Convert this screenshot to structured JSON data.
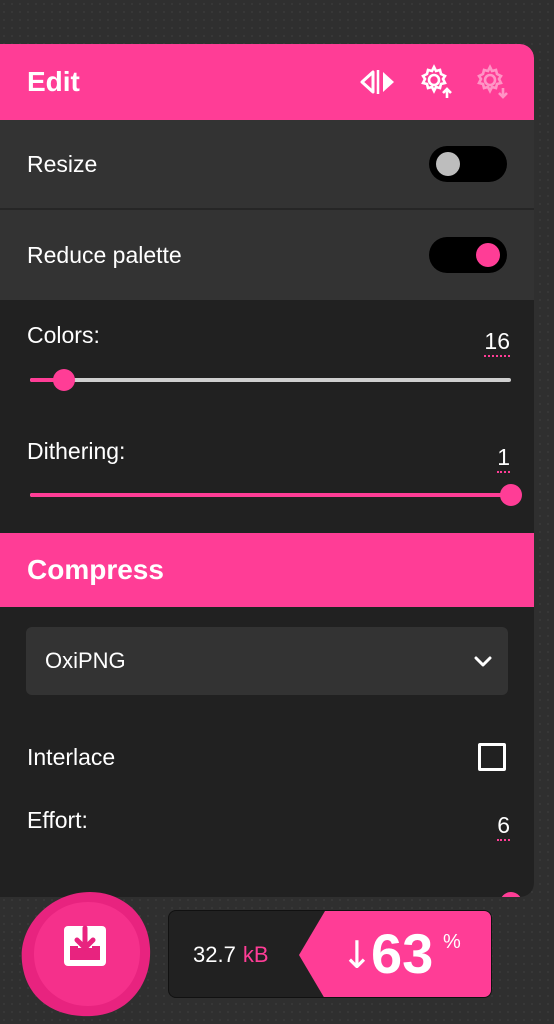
{
  "edit": {
    "title": "Edit",
    "resize_label": "Resize",
    "resize_enabled": false,
    "reduce_palette_label": "Reduce palette",
    "reduce_palette_enabled": true,
    "colors_label": "Colors:",
    "colors_value": "16",
    "colors_level": 0.07,
    "dithering_label": "Dithering:",
    "dithering_value": "1",
    "dithering_level": 1.0
  },
  "compress": {
    "title": "Compress",
    "codec": "OxiPNG",
    "interlace_label": "Interlace",
    "interlace_checked": false,
    "effort_label": "Effort:",
    "effort_value": "6",
    "effort_level": 1.0
  },
  "results": {
    "size_value": "32.7",
    "size_unit": "kB",
    "reduction_arrow": "↓",
    "reduction_value": "63",
    "reduction_unit": "%"
  },
  "icons": {
    "flip": "flip-horizontal-icon",
    "settings_up": "settings-upload-icon",
    "settings_down": "settings-download-icon",
    "download": "download-tray-icon",
    "chevron": "chevron-down-icon"
  },
  "colors": {
    "accent": "#ff3d96",
    "panel": "#333333",
    "panel_dark": "#212121"
  }
}
